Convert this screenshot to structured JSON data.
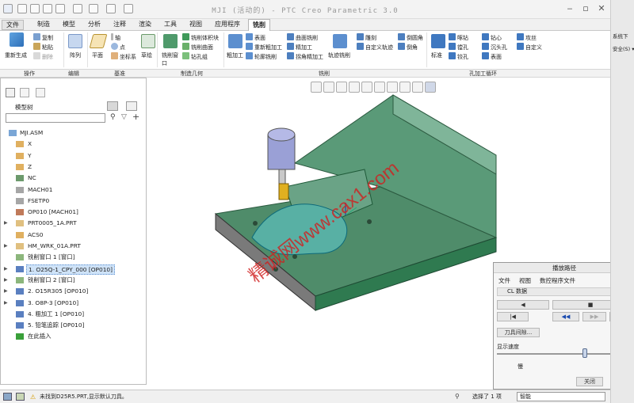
{
  "window": {
    "title": "MJI (活动的) - PTC Creo Parametric 3.0"
  },
  "menu_tabs": [
    "文件",
    "制造",
    "模型",
    "分析",
    "注释",
    "渲染",
    "工具",
    "视图",
    "应用程序",
    "铣削"
  ],
  "ribbon": {
    "operate": {
      "regen": "重新生成",
      "copy": "复制",
      "paste": "粘贴",
      "delete": "删除"
    },
    "edit": {
      "array": "阵列"
    },
    "datum": {
      "plane": "平面",
      "axis": "轴",
      "point": "点",
      "csys": "坐标系",
      "sketch": "草绘"
    },
    "geometry": {
      "mill_window": "铣削窗口",
      "mill_volume": "铣削体积块",
      "mill_surface": "铣削曲面",
      "drill_group": "钻孔组"
    },
    "milling": {
      "rough": "粗加工",
      "surface": "表面",
      "rerough": "重新粗加工",
      "contour": "轮廓铣削",
      "curve_mill": "曲面铣削",
      "finish": "精加工",
      "corner_finish": "拐角精加工",
      "traj": "轨迹铣削",
      "engrave": "雕刻",
      "custom_traj": "自定义轨迹",
      "chamfer": "倒角",
      "round": "倒圆角"
    },
    "holes": {
      "standard": "标准",
      "drill": "啄钻",
      "bore": "镗孔",
      "ream": "铰孔",
      "spot": "钻心",
      "countersink": "沉头孔",
      "face": "表面",
      "tap": "攻丝",
      "custom": "自定义"
    }
  },
  "groups": {
    "operate": "操作",
    "edit": "编辑",
    "datum": "基准",
    "geometry": "制造几何",
    "milling": "铣削",
    "holes": "孔加工循环"
  },
  "model_tree": {
    "title": "模型树",
    "items": [
      {
        "label": "MJI.ASM",
        "expand": false
      },
      {
        "label": "X",
        "expand": false
      },
      {
        "label": "Y",
        "expand": false
      },
      {
        "label": "Z",
        "expand": false
      },
      {
        "label": "NC",
        "expand": false
      },
      {
        "label": "MACH01",
        "expand": false
      },
      {
        "label": "FSETP0",
        "expand": false
      },
      {
        "label": "OP010 [MACH01]",
        "expand": false
      },
      {
        "label": "PRT0005_1A.PRT",
        "expand": true
      },
      {
        "label": "ACS0",
        "expand": false
      },
      {
        "label": "HM_WRK_01A.PRT",
        "expand": true
      },
      {
        "label": "铣削窗口 1 [窗口]",
        "expand": false
      },
      {
        "label": "1. O25Q-1_CPY_000 [OP010]",
        "expand": true
      },
      {
        "label": "铣削窗口 2 [窗口]",
        "expand": true
      },
      {
        "label": "2. O15R305 [OP010]",
        "expand": true
      },
      {
        "label": "3. O8P-3 [OP010]",
        "expand": true
      },
      {
        "label": "4. 粗加工 1 [OP010]",
        "expand": false
      },
      {
        "label": "5. 铅笔追踪 [OP010]",
        "expand": false
      },
      {
        "label": "在此插入",
        "expand": false
      }
    ]
  },
  "status": {
    "message": "未找到D25R5.PRT,显示默认刀具。",
    "selected": "选择了 1 项",
    "filter": "智能"
  },
  "side": {
    "item1": "系统下",
    "item2": "安全(S) ▾"
  },
  "dialog": {
    "title": "播放路径",
    "menu": [
      "文件",
      "视图",
      "数控程序文件"
    ],
    "cl": "CL 数据",
    "tool_gap": "刀具间隙...",
    "speed_label": "显示速度",
    "slow": "慢",
    "close": "关闭"
  },
  "watermark": "精诚网www.cax1.com"
}
